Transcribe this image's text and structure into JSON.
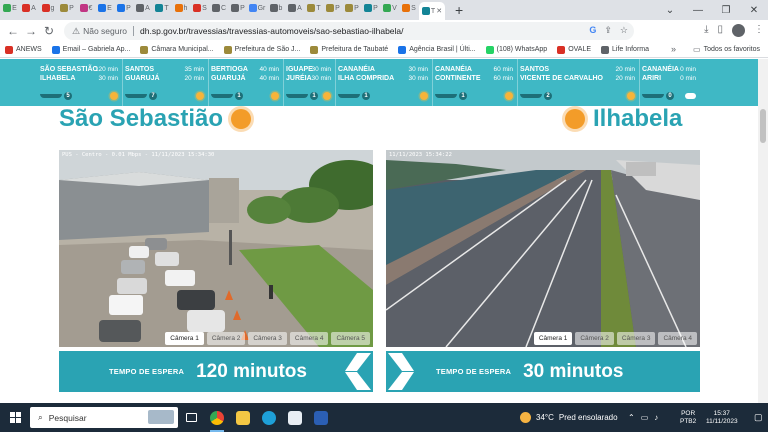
{
  "browser": {
    "tabs": [
      {
        "letter": "E",
        "color": "#34a853"
      },
      {
        "letter": "A",
        "color": "#d93025"
      },
      {
        "letter": "g",
        "color": "#d93025"
      },
      {
        "letter": "P",
        "color": "#9c8a3b"
      },
      {
        "letter": "€",
        "color": "#c13584"
      },
      {
        "letter": "E",
        "color": "#1a73e8"
      },
      {
        "letter": "P",
        "color": "#1a73e8"
      },
      {
        "letter": "A",
        "color": "#5f6368"
      },
      {
        "letter": "T",
        "color": "#138496"
      },
      {
        "letter": "h",
        "color": "#e8710a"
      },
      {
        "letter": "S",
        "color": "#d93025"
      },
      {
        "letter": "C",
        "color": "#5f6368"
      },
      {
        "letter": "P",
        "color": "#5f6368"
      },
      {
        "letter": "Gr",
        "color": "#4285f4"
      },
      {
        "letter": "b",
        "color": "#5f6368"
      },
      {
        "letter": "A",
        "color": "#5f6368"
      },
      {
        "letter": "T",
        "color": "#9c8a3b"
      },
      {
        "letter": "P",
        "color": "#9c8a3b"
      },
      {
        "letter": "P",
        "color": "#9c8a3b"
      },
      {
        "letter": "P",
        "color": "#138496"
      },
      {
        "letter": "V",
        "color": "#34a853"
      },
      {
        "letter": "S",
        "color": "#e8710a"
      },
      {
        "letter": "T",
        "color": "#138496"
      }
    ],
    "new_tab": "+",
    "window_controls": [
      "⌄",
      "—",
      "❐",
      "✕"
    ],
    "address": {
      "security_label": "Não seguro",
      "url": "dh.sp.gov.br/travessias/travessias-automoveis/sao-sebastiao-ilhabela/"
    },
    "bookmarks": [
      {
        "label": "ANEWS",
        "color": "#d93025"
      },
      {
        "label": "Email – Gabriela Ap...",
        "color": "#1a73e8"
      },
      {
        "label": "Câmara Municipal...",
        "color": "#9c8a3b"
      },
      {
        "label": "Prefeitura de São J...",
        "color": "#9c8a3b"
      },
      {
        "label": "Prefeitura de Taubaté",
        "color": "#9c8a3b"
      },
      {
        "label": "Agência Brasil | Últi...",
        "color": "#1a73e8"
      },
      {
        "label": "(108) WhatsApp",
        "color": "#25d366"
      },
      {
        "label": "OVALE",
        "color": "#d93025"
      },
      {
        "label": "Life Informa",
        "color": "#5f6368"
      }
    ],
    "bookmarks_more": "»",
    "all_bookmarks": "Todos os favoritos"
  },
  "status": [
    {
      "name1": "São Sebastião",
      "name2": "Ilhabela",
      "t1": "120 min",
      "t2": "30 min",
      "ferries": "5",
      "weather": "sun"
    },
    {
      "name1": "Santos",
      "name2": "Guarujá",
      "t1": "35 min",
      "t2": "20 min",
      "ferries": "7",
      "weather": "sun"
    },
    {
      "name1": "Bertioga",
      "name2": "Guarujá",
      "t1": "40 min",
      "t2": "40 min",
      "ferries": "1",
      "weather": "sun"
    },
    {
      "name1": "Iguape",
      "name2": "Juréia",
      "t1": "30 min",
      "t2": "30 min",
      "ferries": "1",
      "weather": "sun"
    },
    {
      "name1": "Cananéia",
      "name2": "Ilha Comprida",
      "t1": "30 min",
      "t2": "30 min",
      "ferries": "1",
      "weather": "sun"
    },
    {
      "name1": "Cananéia",
      "name2": "Continente",
      "t1": "60 min",
      "t2": "60 min",
      "ferries": "1",
      "weather": "sun"
    },
    {
      "name1": "Santos",
      "name2": "Vicente de Carvalho",
      "t1": "20 min",
      "t2": "20 min",
      "ferries": "2",
      "weather": "sun"
    },
    {
      "name1": "Cananéia",
      "name2": "Ariri",
      "t1": "0 min",
      "t2": "0 min",
      "ferries": "0",
      "weather": "cloud"
    }
  ],
  "left": {
    "title": "São Sebastião",
    "timestamp": "PUS - Centro - 0.01 Mbps - 11/11/2023 15:34:30",
    "cameras": [
      "Câmera 1",
      "Câmera 2",
      "Câmera 3",
      "Câmera 4",
      "Câmera 5"
    ],
    "wait_label": "TEMPO DE ESPERA",
    "wait_value": "120 minutos"
  },
  "right": {
    "title": "Ilhabela",
    "timestamp": "11/11/2023 15:34:22",
    "cameras": [
      "Câmera 1",
      "Câmera 2",
      "Câmera 3",
      "Câmera 4"
    ],
    "wait_label": "TEMPO DE ESPERA",
    "wait_value": "30 minutos"
  },
  "taskbar": {
    "search_placeholder": "Pesquisar",
    "weather_temp": "34°C",
    "weather_desc": "Pred ensolarado",
    "lang1": "POR",
    "lang2": "PTB2",
    "time": "15:37",
    "date": "11/11/2023"
  }
}
